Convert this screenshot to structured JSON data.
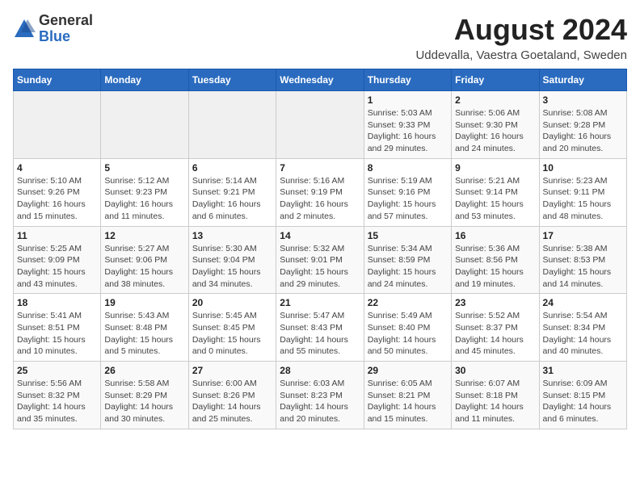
{
  "header": {
    "logo_line1": "General",
    "logo_line2": "Blue",
    "month_title": "August 2024",
    "location": "Uddevalla, Vaestra Goetaland, Sweden"
  },
  "weekdays": [
    "Sunday",
    "Monday",
    "Tuesday",
    "Wednesday",
    "Thursday",
    "Friday",
    "Saturday"
  ],
  "weeks": [
    [
      {
        "day": "",
        "info": ""
      },
      {
        "day": "",
        "info": ""
      },
      {
        "day": "",
        "info": ""
      },
      {
        "day": "",
        "info": ""
      },
      {
        "day": "1",
        "info": "Sunrise: 5:03 AM\nSunset: 9:33 PM\nDaylight: 16 hours\nand 29 minutes."
      },
      {
        "day": "2",
        "info": "Sunrise: 5:06 AM\nSunset: 9:30 PM\nDaylight: 16 hours\nand 24 minutes."
      },
      {
        "day": "3",
        "info": "Sunrise: 5:08 AM\nSunset: 9:28 PM\nDaylight: 16 hours\nand 20 minutes."
      }
    ],
    [
      {
        "day": "4",
        "info": "Sunrise: 5:10 AM\nSunset: 9:26 PM\nDaylight: 16 hours\nand 15 minutes."
      },
      {
        "day": "5",
        "info": "Sunrise: 5:12 AM\nSunset: 9:23 PM\nDaylight: 16 hours\nand 11 minutes."
      },
      {
        "day": "6",
        "info": "Sunrise: 5:14 AM\nSunset: 9:21 PM\nDaylight: 16 hours\nand 6 minutes."
      },
      {
        "day": "7",
        "info": "Sunrise: 5:16 AM\nSunset: 9:19 PM\nDaylight: 16 hours\nand 2 minutes."
      },
      {
        "day": "8",
        "info": "Sunrise: 5:19 AM\nSunset: 9:16 PM\nDaylight: 15 hours\nand 57 minutes."
      },
      {
        "day": "9",
        "info": "Sunrise: 5:21 AM\nSunset: 9:14 PM\nDaylight: 15 hours\nand 53 minutes."
      },
      {
        "day": "10",
        "info": "Sunrise: 5:23 AM\nSunset: 9:11 PM\nDaylight: 15 hours\nand 48 minutes."
      }
    ],
    [
      {
        "day": "11",
        "info": "Sunrise: 5:25 AM\nSunset: 9:09 PM\nDaylight: 15 hours\nand 43 minutes."
      },
      {
        "day": "12",
        "info": "Sunrise: 5:27 AM\nSunset: 9:06 PM\nDaylight: 15 hours\nand 38 minutes."
      },
      {
        "day": "13",
        "info": "Sunrise: 5:30 AM\nSunset: 9:04 PM\nDaylight: 15 hours\nand 34 minutes."
      },
      {
        "day": "14",
        "info": "Sunrise: 5:32 AM\nSunset: 9:01 PM\nDaylight: 15 hours\nand 29 minutes."
      },
      {
        "day": "15",
        "info": "Sunrise: 5:34 AM\nSunset: 8:59 PM\nDaylight: 15 hours\nand 24 minutes."
      },
      {
        "day": "16",
        "info": "Sunrise: 5:36 AM\nSunset: 8:56 PM\nDaylight: 15 hours\nand 19 minutes."
      },
      {
        "day": "17",
        "info": "Sunrise: 5:38 AM\nSunset: 8:53 PM\nDaylight: 15 hours\nand 14 minutes."
      }
    ],
    [
      {
        "day": "18",
        "info": "Sunrise: 5:41 AM\nSunset: 8:51 PM\nDaylight: 15 hours\nand 10 minutes."
      },
      {
        "day": "19",
        "info": "Sunrise: 5:43 AM\nSunset: 8:48 PM\nDaylight: 15 hours\nand 5 minutes."
      },
      {
        "day": "20",
        "info": "Sunrise: 5:45 AM\nSunset: 8:45 PM\nDaylight: 15 hours\nand 0 minutes."
      },
      {
        "day": "21",
        "info": "Sunrise: 5:47 AM\nSunset: 8:43 PM\nDaylight: 14 hours\nand 55 minutes."
      },
      {
        "day": "22",
        "info": "Sunrise: 5:49 AM\nSunset: 8:40 PM\nDaylight: 14 hours\nand 50 minutes."
      },
      {
        "day": "23",
        "info": "Sunrise: 5:52 AM\nSunset: 8:37 PM\nDaylight: 14 hours\nand 45 minutes."
      },
      {
        "day": "24",
        "info": "Sunrise: 5:54 AM\nSunset: 8:34 PM\nDaylight: 14 hours\nand 40 minutes."
      }
    ],
    [
      {
        "day": "25",
        "info": "Sunrise: 5:56 AM\nSunset: 8:32 PM\nDaylight: 14 hours\nand 35 minutes."
      },
      {
        "day": "26",
        "info": "Sunrise: 5:58 AM\nSunset: 8:29 PM\nDaylight: 14 hours\nand 30 minutes."
      },
      {
        "day": "27",
        "info": "Sunrise: 6:00 AM\nSunset: 8:26 PM\nDaylight: 14 hours\nand 25 minutes."
      },
      {
        "day": "28",
        "info": "Sunrise: 6:03 AM\nSunset: 8:23 PM\nDaylight: 14 hours\nand 20 minutes."
      },
      {
        "day": "29",
        "info": "Sunrise: 6:05 AM\nSunset: 8:21 PM\nDaylight: 14 hours\nand 15 minutes."
      },
      {
        "day": "30",
        "info": "Sunrise: 6:07 AM\nSunset: 8:18 PM\nDaylight: 14 hours\nand 11 minutes."
      },
      {
        "day": "31",
        "info": "Sunrise: 6:09 AM\nSunset: 8:15 PM\nDaylight: 14 hours\nand 6 minutes."
      }
    ]
  ]
}
